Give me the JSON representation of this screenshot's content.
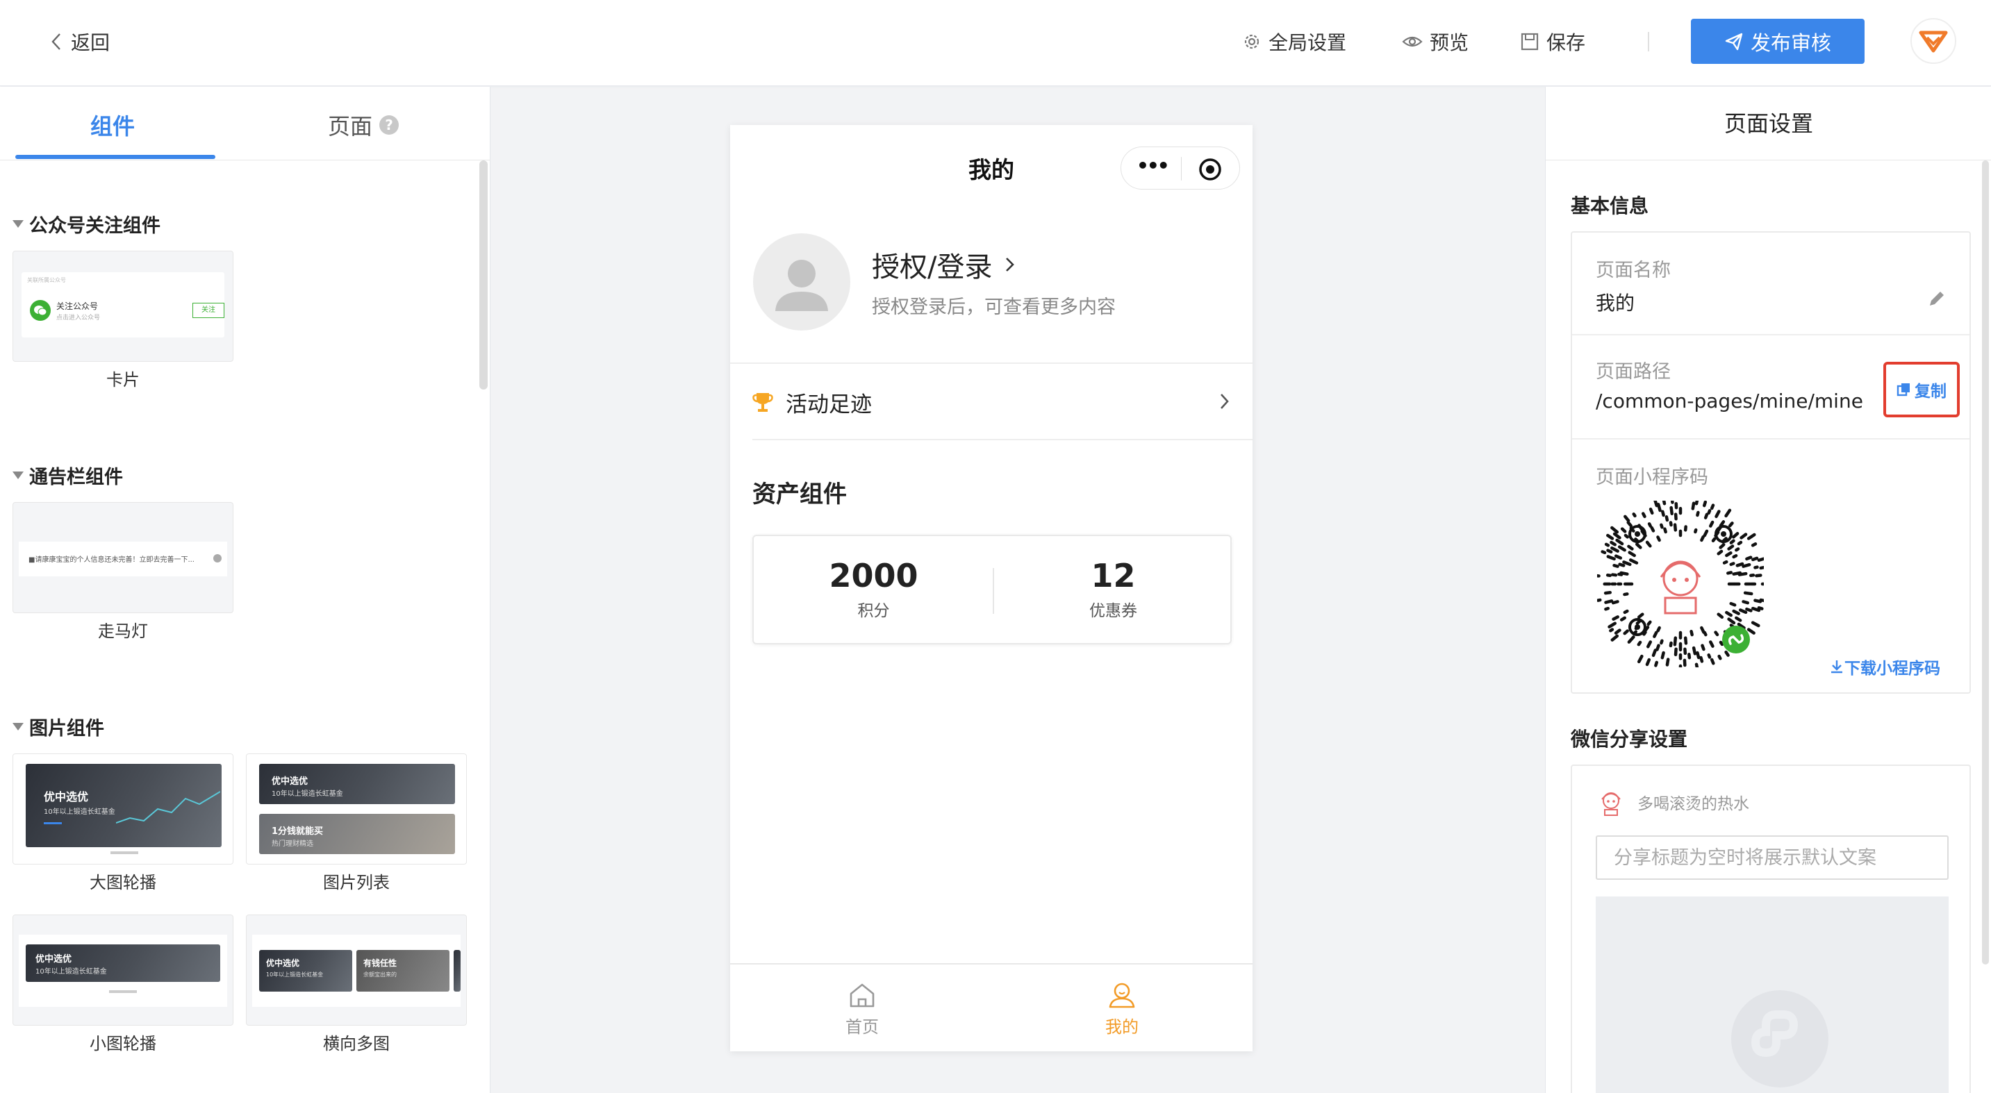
{
  "topbar": {
    "back_label": "返回",
    "global_settings_label": "全局设置",
    "preview_label": "预览",
    "save_label": "保存",
    "publish_label": "发布审核"
  },
  "left_panel": {
    "tabs": {
      "components": "组件",
      "page": "页面",
      "page_help": "?"
    },
    "sections": {
      "follow": {
        "title": "公众号关注组件",
        "cards": [
          {
            "label": "卡片",
            "preview_caption": "关联所属公众号",
            "preview_title": "关注公众号",
            "preview_sub": "点击进入公众号",
            "preview_button": "关注"
          }
        ]
      },
      "notice": {
        "title": "通告栏组件",
        "cards": [
          {
            "label": "走马灯",
            "preview_text": "■请康康宝宝的个人信息还未完善！立即去完善一下..."
          }
        ]
      },
      "image": {
        "title": "图片组件",
        "cards": [
          {
            "label": "大图轮播",
            "preview_title": "优中选优",
            "preview_sub": "10年以上锻造长虹基金"
          },
          {
            "label": "图片列表",
            "preview_title": "优中选优",
            "preview_sub": "10年以上锻造长虹基金",
            "preview_title2": "1分钱就能买",
            "preview_sub2": "热门理财精选"
          },
          {
            "label": "小图轮播",
            "preview_title": "优中选优",
            "preview_sub": "10年以上锻造长虹基金"
          },
          {
            "label": "横向多图",
            "preview_title": "优中选优",
            "preview_sub": "10年以上锻造长虹基金",
            "preview_title2": "有钱任性",
            "preview_sub2": "余额宝出来的"
          }
        ]
      }
    }
  },
  "phone": {
    "title": "我的",
    "capsule_more": "•••",
    "login_title": "授权/登录",
    "login_sub": "授权登录后，可查看更多内容",
    "activity_label": "活动足迹",
    "asset_title": "资产组件",
    "assets": [
      {
        "value": "2000",
        "label": "积分"
      },
      {
        "value": "12",
        "label": "优惠券"
      }
    ],
    "tabbar": [
      {
        "label": "首页",
        "icon": "home-icon",
        "active": false
      },
      {
        "label": "我的",
        "icon": "user-icon",
        "active": true
      }
    ]
  },
  "right_panel": {
    "header": "页面设置",
    "basic_info_title": "基本信息",
    "page_name_label": "页面名称",
    "page_name_value": "我的",
    "page_path_label": "页面路径",
    "page_path_value": "/common-pages/mine/mine",
    "copy_label": "复制",
    "qr_label": "页面小程序码",
    "download_label": "下载小程序码",
    "share_title": "微信分享设置",
    "share_user": "多喝滚烫的热水",
    "share_placeholder": "分享标题为空时将展示默认文案"
  },
  "colors": {
    "primary": "#3b86ea",
    "active_tab": "#f29b27",
    "highlight_border": "#e23d2e"
  }
}
